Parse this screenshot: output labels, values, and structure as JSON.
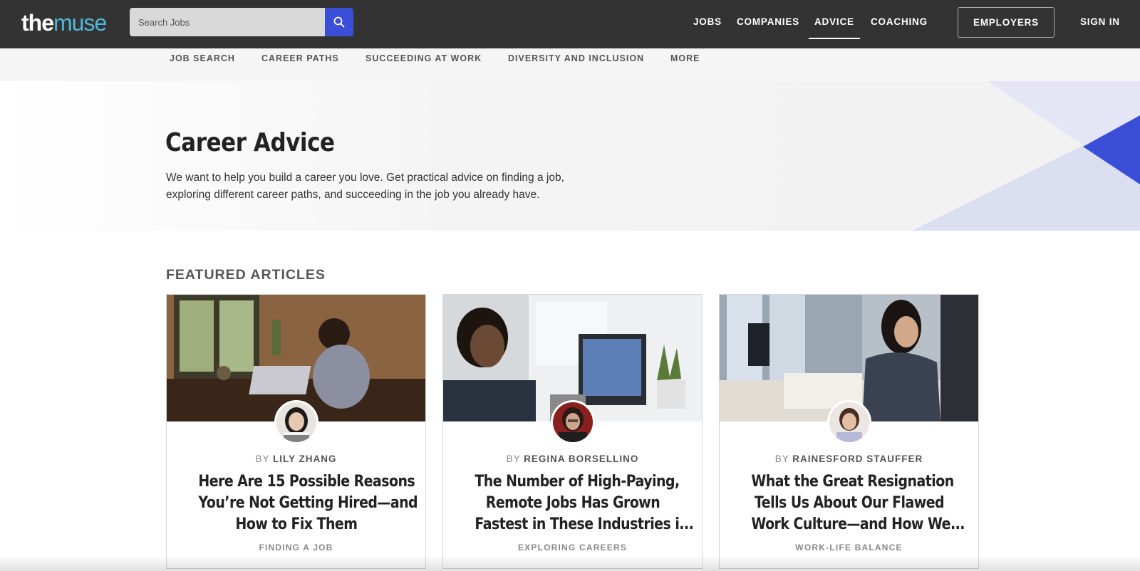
{
  "header": {
    "logo": {
      "the": "the",
      "muse": "muse"
    },
    "search": {
      "placeholder": "Search Jobs",
      "value": ""
    },
    "nav": [
      {
        "label": "JOBS"
      },
      {
        "label": "COMPANIES"
      },
      {
        "label": "ADVICE",
        "active": true
      },
      {
        "label": "COACHING"
      }
    ],
    "employers_label": "EMPLOYERS",
    "signin_label": "SIGN IN"
  },
  "subnav": [
    {
      "label": "JOB SEARCH"
    },
    {
      "label": "CAREER PATHS"
    },
    {
      "label": "SUCCEEDING AT WORK"
    },
    {
      "label": "DIVERSITY AND INCLUSION"
    },
    {
      "label": "MORE"
    }
  ],
  "hero": {
    "title": "Career Advice",
    "description": "We want to help you build a career you love. Get practical advice on finding a job, exploring different career paths, and succeeding in the job you already have."
  },
  "featured": {
    "title": "FEATURED ARTICLES",
    "by_label": "BY",
    "articles": [
      {
        "author": "LILY ZHANG",
        "title_lines": [
          "Here Are 15 Possible Reasons",
          "You’re Not Getting Hired—and",
          "How to Fix Them"
        ],
        "category": "FINDING A JOB"
      },
      {
        "author": "REGINA BORSELLINO",
        "title_lines": [
          "The Number of High-Paying,",
          "Remote Jobs Has Grown",
          "Fastest in These Industries i..."
        ],
        "category": "EXPLORING CAREERS"
      },
      {
        "author": "RAINESFORD STAUFFER",
        "title_lines": [
          "What the Great Resignation",
          "Tells Us About Our Flawed",
          "Work Culture—and How We..."
        ],
        "category": "WORK-LIFE BALANCE"
      }
    ]
  },
  "colors": {
    "topbar": "#333333",
    "accent": "#3b4ed8",
    "logo_muse": "#4fb8d6"
  },
  "icons": {
    "search": "search-icon"
  }
}
